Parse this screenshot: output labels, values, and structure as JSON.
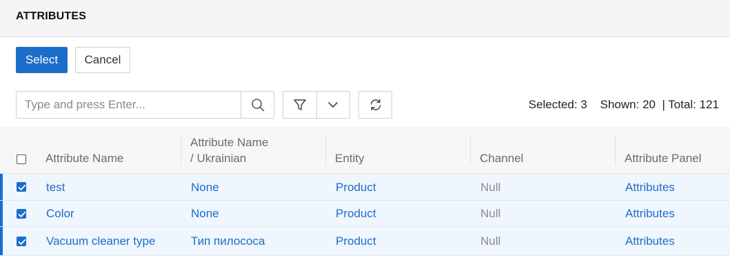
{
  "header": {
    "title": "ATTRIBUTES"
  },
  "actions": {
    "select_label": "Select",
    "cancel_label": "Cancel"
  },
  "search": {
    "placeholder": "Type and press Enter...",
    "value": ""
  },
  "icons": {
    "search": "search-icon",
    "filter": "filter-icon",
    "dropdown": "chevron-down-icon",
    "refresh": "refresh-icon",
    "checkbox": "checkbox-icon"
  },
  "counts": {
    "selected": "Selected: 3",
    "shown": "Shown: 20",
    "total": "| Total: 121"
  },
  "table": {
    "columns": [
      {
        "line1": "Attribute Name",
        "line2": ""
      },
      {
        "line1": "Attribute Name",
        "line2": "/ Ukrainian"
      },
      {
        "line1": "Entity",
        "line2": ""
      },
      {
        "line1": "Channel",
        "line2": ""
      },
      {
        "line1": "Attribute Panel",
        "line2": ""
      }
    ],
    "rows": [
      {
        "checked": true,
        "name": "test",
        "name_uk": "None",
        "entity": "Product",
        "channel": "Null",
        "panel": "Attributes"
      },
      {
        "checked": true,
        "name": "Color",
        "name_uk": "None",
        "entity": "Product",
        "channel": "Null",
        "panel": "Attributes"
      },
      {
        "checked": true,
        "name": "Vacuum cleaner type",
        "name_uk": "Тип пилососа",
        "entity": "Product",
        "channel": "Null",
        "panel": "Attributes"
      }
    ]
  },
  "colors": {
    "accent": "#1a6ec9",
    "row_bg": "#f0f6fd",
    "header_bg": "#f5f5f5",
    "muted": "#8a8a8a"
  }
}
